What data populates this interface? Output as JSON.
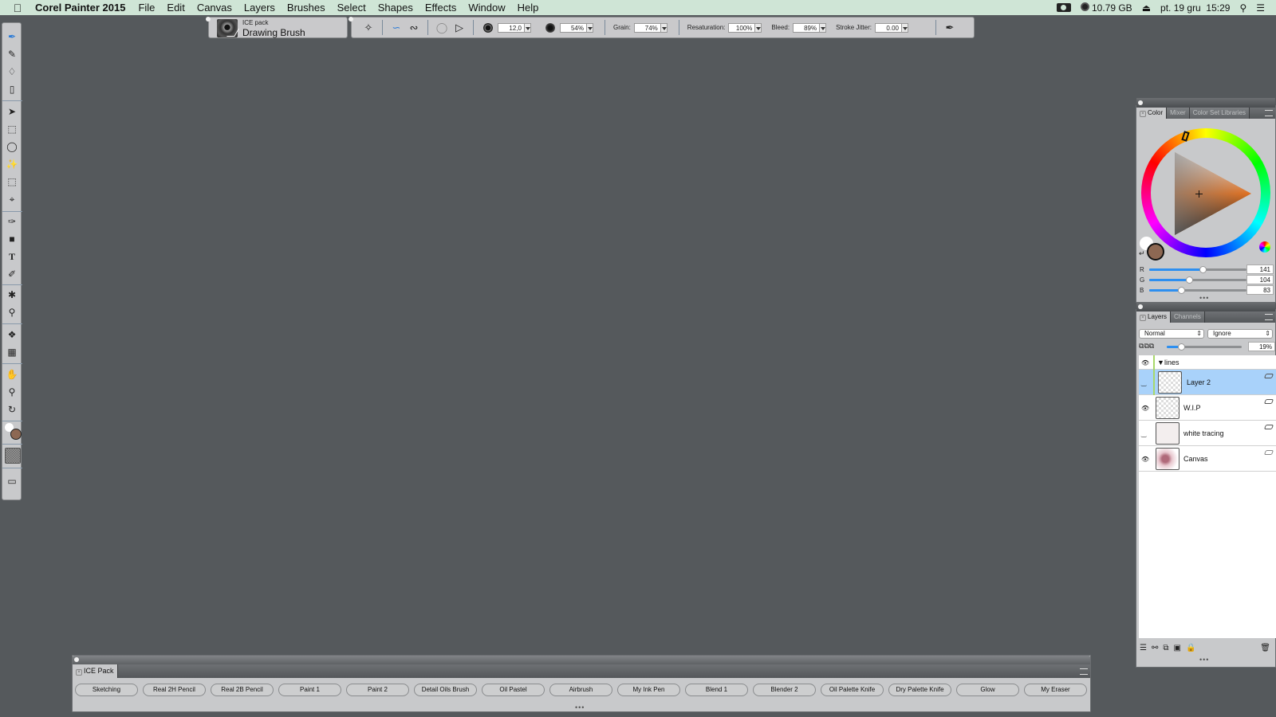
{
  "menubar": {
    "app_name": "Corel Painter 2015",
    "items": [
      "File",
      "Edit",
      "Canvas",
      "Layers",
      "Brushes",
      "Select",
      "Shapes",
      "Effects",
      "Window",
      "Help"
    ],
    "status": {
      "disk": "10.79 GB",
      "datetime": "pt. 19 gru  15:29"
    }
  },
  "brush_selector": {
    "category": "ICE pack",
    "variant": "Drawing Brush"
  },
  "property_bar": {
    "size_value": "12,0",
    "opacity_value": "54%",
    "grain_label": "Grain:",
    "grain_value": "74%",
    "resaturation_label": "Resaturation:",
    "resaturation_value": "100%",
    "bleed_label": "Bleed:",
    "bleed_value": "89%",
    "stroke_jitter_label": "Stroke Jitter:",
    "stroke_jitter_value": "0.00"
  },
  "toolbox": {
    "tools": [
      "brush",
      "dropper",
      "paint-bucket",
      "eraser",
      "layer-adjuster",
      "rect-selection",
      "lasso",
      "magic-wand",
      "transform",
      "crop",
      "pen",
      "rectangle-shape",
      "text",
      "shape-selection",
      "cloner",
      "rubber-stamp",
      "mirror-painting",
      "divine-proportion",
      "grabber",
      "magnifier",
      "rotate-page"
    ],
    "main_color": "#8d6853",
    "additional_color": "#ffffff"
  },
  "color_panel": {
    "tabs": [
      "Color",
      "Mixer",
      "Color Set Libraries"
    ],
    "active_tab": "Color",
    "current_color": "#8d6853",
    "rgb": {
      "r_label": "R",
      "r": "141",
      "g_label": "G",
      "g": "104",
      "b_label": "B",
      "b": "83"
    },
    "rgb_fraction": {
      "r": 0.553,
      "g": 0.408,
      "b": 0.325
    }
  },
  "layers_panel": {
    "tabs": [
      "Layers",
      "Channels"
    ],
    "active_tab": "Layers",
    "blend_mode": "Normal",
    "composite": "Ignore",
    "opacity": "19%",
    "opacity_fraction": 0.19,
    "group_name": "lines",
    "layers": [
      {
        "name": "Layer 2",
        "visible": false,
        "selected": true
      },
      {
        "name": "W.I.P",
        "visible": true,
        "selected": false
      },
      {
        "name": "white tracing",
        "visible": false,
        "selected": false
      },
      {
        "name": "Canvas",
        "visible": true,
        "selected": false
      }
    ]
  },
  "brush_library_strip": {
    "tab": "ICE Pack",
    "brushes": [
      "Sketching",
      "Real 2H Pencil",
      "Real 2B Pencil",
      "Paint 1",
      "Paint 2",
      "Detail Oils Brush",
      "Oil Pastel",
      "Airbrush",
      "My Ink Pen",
      "Blend 1",
      "Blender 2",
      "Oil Palette Knife",
      "Dry Palette Knife",
      "Glow",
      "My Eraser"
    ]
  }
}
